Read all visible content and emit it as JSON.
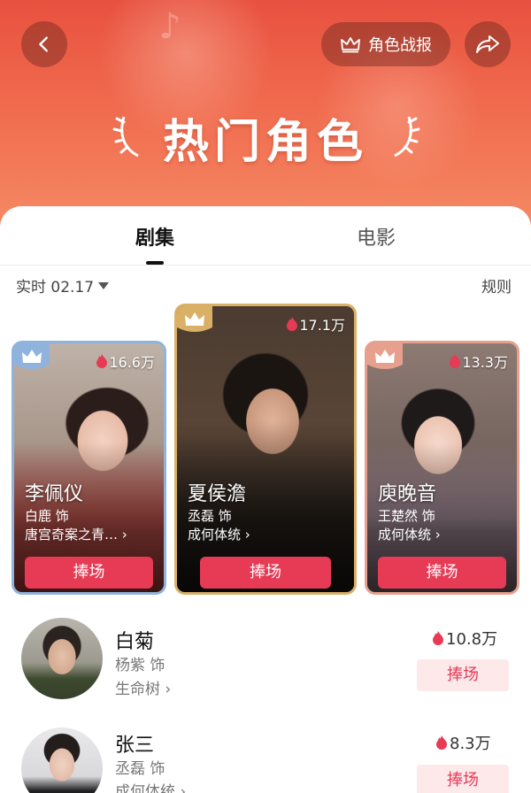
{
  "header": {
    "title": "热门角色",
    "report_label": "角色战报"
  },
  "tabs": [
    {
      "label": "剧集",
      "active": true
    },
    {
      "label": "电影",
      "active": false
    }
  ],
  "filter": {
    "date_label": "实时 02.17",
    "rules_label": "规则"
  },
  "top_three": [
    {
      "rank": 2,
      "heat": "16.6万",
      "name": "李佩仪",
      "actor": "白鹿 饰",
      "show": "唐宫奇案之青…",
      "cheer": "捧场"
    },
    {
      "rank": 1,
      "heat": "17.1万",
      "name": "夏侯澹",
      "actor": "丞磊 饰",
      "show": "成何体统",
      "cheer": "捧场"
    },
    {
      "rank": 3,
      "heat": "13.3万",
      "name": "庾晚音",
      "actor": "王楚然 饰",
      "show": "成何体统",
      "cheer": "捧场"
    }
  ],
  "list": [
    {
      "name": "白菊",
      "actor": "杨紫 饰",
      "show": "生命树",
      "heat": "10.8万",
      "cheer": "捧场"
    },
    {
      "name": "张三",
      "actor": "丞磊 饰",
      "show": "成何体统",
      "heat": "8.3万",
      "cheer": "捧场"
    }
  ],
  "colors": {
    "accent": "#e63a55",
    "hero": "#ea5640",
    "gold": "#d9b066",
    "silver": "#8fb3dc",
    "bronze": "#e7a08e"
  }
}
